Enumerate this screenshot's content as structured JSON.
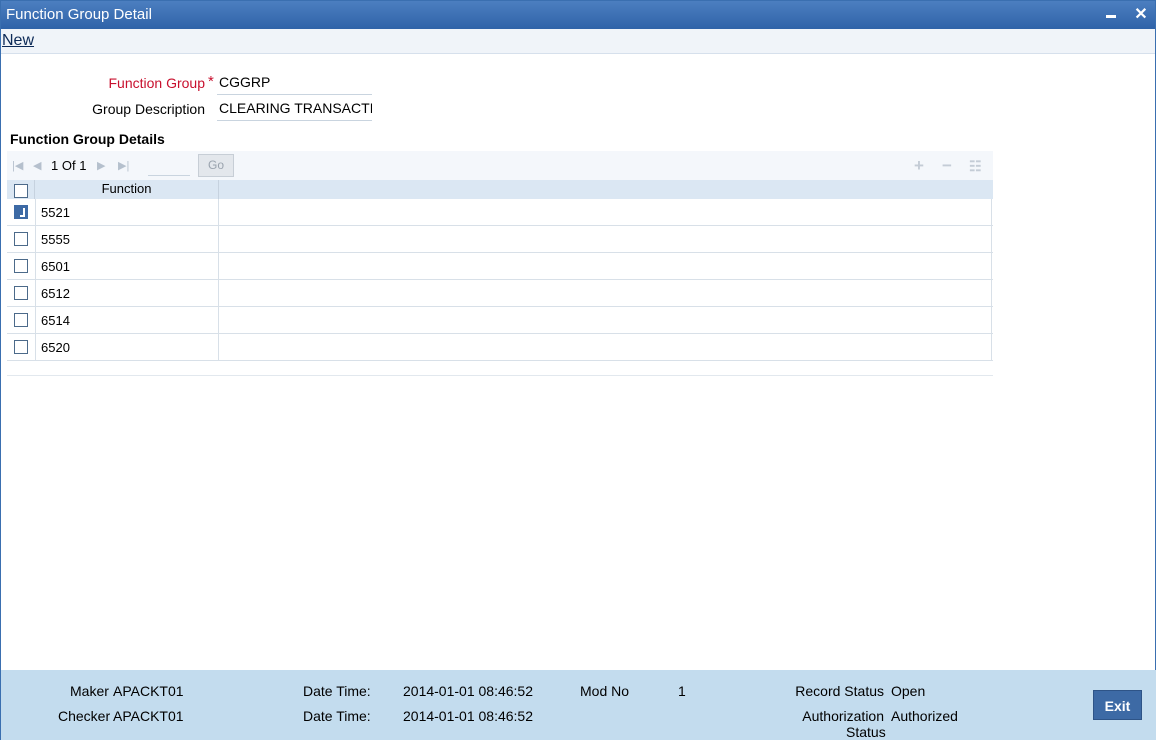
{
  "window": {
    "title": "Function Group Detail",
    "minimize_icon": "minimize-icon",
    "close_icon": "close-icon",
    "close_glyph": "✕"
  },
  "toolbar": {
    "new_label": "New"
  },
  "form": {
    "function_group_label": "Function Group",
    "required_marker": "*",
    "function_group_value": "CGGRP",
    "group_description_label": "Group Description",
    "group_description_value": "CLEARING TRANSACTIO"
  },
  "details": {
    "title": "Function Group Details",
    "pager": {
      "current": "1",
      "of_label": "Of",
      "total": "1",
      "go_label": "Go",
      "page_input": ""
    },
    "column_header": "Function",
    "rows": [
      {
        "function": "5521",
        "checked": true
      },
      {
        "function": "5555",
        "checked": false
      },
      {
        "function": "6501",
        "checked": false
      },
      {
        "function": "6512",
        "checked": false
      },
      {
        "function": "6514",
        "checked": false
      },
      {
        "function": "6520",
        "checked": false
      }
    ]
  },
  "footer": {
    "maker_label": "Maker",
    "maker_value": "APACKT01",
    "checker_label": "Checker",
    "checker_value": "APACKT01",
    "date_time_label": "Date Time:",
    "maker_date_time": "2014-01-01 08:46:52",
    "checker_date_time": "2014-01-01 08:46:52",
    "mod_no_label": "Mod No",
    "mod_no_value": "1",
    "record_status_label": "Record Status",
    "record_status_value": "Open",
    "authorization_label": "Authorization",
    "authorization_status_label": "Status",
    "authorization_value": "Authorized",
    "exit_label": "Exit"
  },
  "colors": {
    "titlebar": "#2f63a8",
    "required": "#c8102e",
    "footer": "#c3dcee",
    "exit_button": "#3d6aa5"
  }
}
